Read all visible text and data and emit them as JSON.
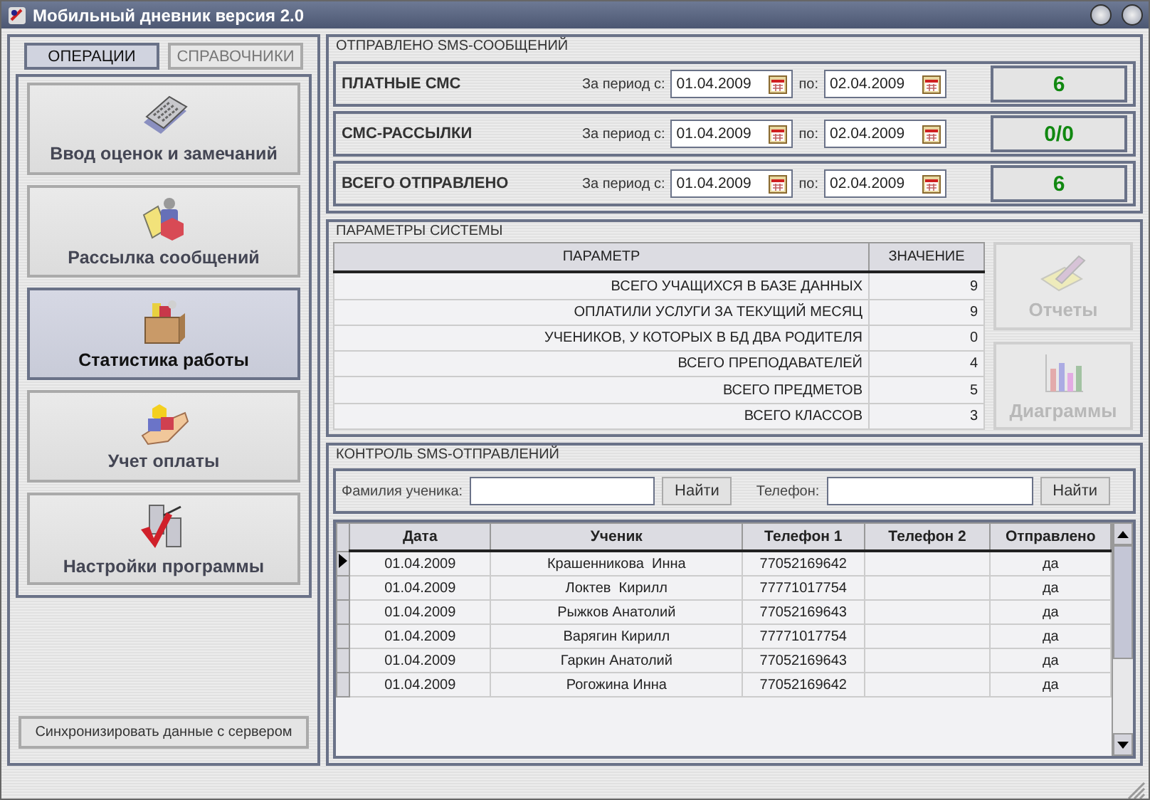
{
  "window": {
    "title": "Мобильный дневник версия 2.0"
  },
  "tabs": [
    {
      "label": "ОПЕРАЦИИ",
      "selected": true
    },
    {
      "label": "СПРАВОЧНИКИ",
      "selected": false
    }
  ],
  "nav_items": [
    {
      "label": "Ввод оценок и замечаний",
      "selected": false
    },
    {
      "label": "Рассылка сообщений",
      "selected": false
    },
    {
      "label": "Статистика работы",
      "selected": true
    },
    {
      "label": "Учет оплаты",
      "selected": false
    },
    {
      "label": "Настройки программы",
      "selected": false
    }
  ],
  "sync_button": "Синхронизировать данные с сервером",
  "sms_sent": {
    "title": "ОТПРАВЛЕНО SMS-СООБЩЕНИЙ",
    "rows": [
      {
        "label": "ПЛАТНЫЕ СМС",
        "from_label": "За период с:",
        "from": "01.04.2009",
        "to_label": "по:",
        "to": "02.04.2009",
        "count": "6"
      },
      {
        "label": "СМС-РАССЫЛКИ",
        "from_label": "За период с:",
        "from": "01.04.2009",
        "to_label": "по:",
        "to": "02.04.2009",
        "count": "0/0"
      },
      {
        "label": "ВСЕГО ОТПРАВЛЕНО",
        "from_label": "За период с:",
        "from": "01.04.2009",
        "to_label": "по:",
        "to": "02.04.2009",
        "count": "6"
      }
    ]
  },
  "system_params": {
    "title": "ПАРАМЕТРЫ СИСТЕМЫ",
    "columns": [
      "ПАРАМЕТР",
      "ЗНАЧЕНИЕ"
    ],
    "rows": [
      {
        "parameter": "ВСЕГО УЧАЩИХСЯ В БАЗЕ ДАННЫХ",
        "value": "9"
      },
      {
        "parameter": "ОПЛАТИЛИ УСЛУГИ ЗА ТЕКУЩИЙ МЕСЯЦ",
        "value": "9"
      },
      {
        "parameter": "УЧЕНИКОВ, У КОТОРЫХ В БД ДВА РОДИТЕЛЯ",
        "value": "0"
      },
      {
        "parameter": "ВСЕГО ПРЕПОДАВАТЕЛЕЙ",
        "value": "4"
      },
      {
        "parameter": "ВСЕГО ПРЕДМЕТОВ",
        "value": "5"
      },
      {
        "parameter": "ВСЕГО КЛАССОВ",
        "value": "3"
      }
    ],
    "buttons": [
      {
        "label": "Отчеты",
        "disabled": true
      },
      {
        "label": "Диаграммы",
        "disabled": true
      }
    ]
  },
  "sms_control": {
    "title": "КОНТРОЛЬ SMS-ОТПРАВЛЕНИЙ",
    "searches": [
      {
        "label": "Фамилия ученика:",
        "button": "Найти"
      },
      {
        "label": "Телефон:",
        "button": "Найти"
      }
    ],
    "columns": [
      "Дата",
      "Ученик",
      "Телефон 1",
      "Телефон 2",
      "Отправлено"
    ],
    "rows": [
      {
        "date": "01.04.2009",
        "student": "Крашенникова  Инна",
        "phone1": "77052169642",
        "sent": "да",
        "selected": true
      },
      {
        "date": "01.04.2009",
        "student": "Локтев  Кирилл",
        "phone1": "77771017754",
        "sent": "да",
        "selected": false
      },
      {
        "date": "01.04.2009",
        "student": "Рыжков Анатолий",
        "phone1": "77052169643",
        "sent": "да",
        "selected": false
      },
      {
        "date": "01.04.2009",
        "student": "Варягин Кирилл",
        "phone1": "77771017754",
        "sent": "да",
        "selected": false
      },
      {
        "date": "01.04.2009",
        "student": "Гаркин Анатолий",
        "phone1": "77052169643",
        "sent": "да",
        "selected": false
      },
      {
        "date": "01.04.2009",
        "student": "Рогожина Инна",
        "phone1": "77052169642",
        "sent": "да",
        "selected": false
      }
    ]
  }
}
